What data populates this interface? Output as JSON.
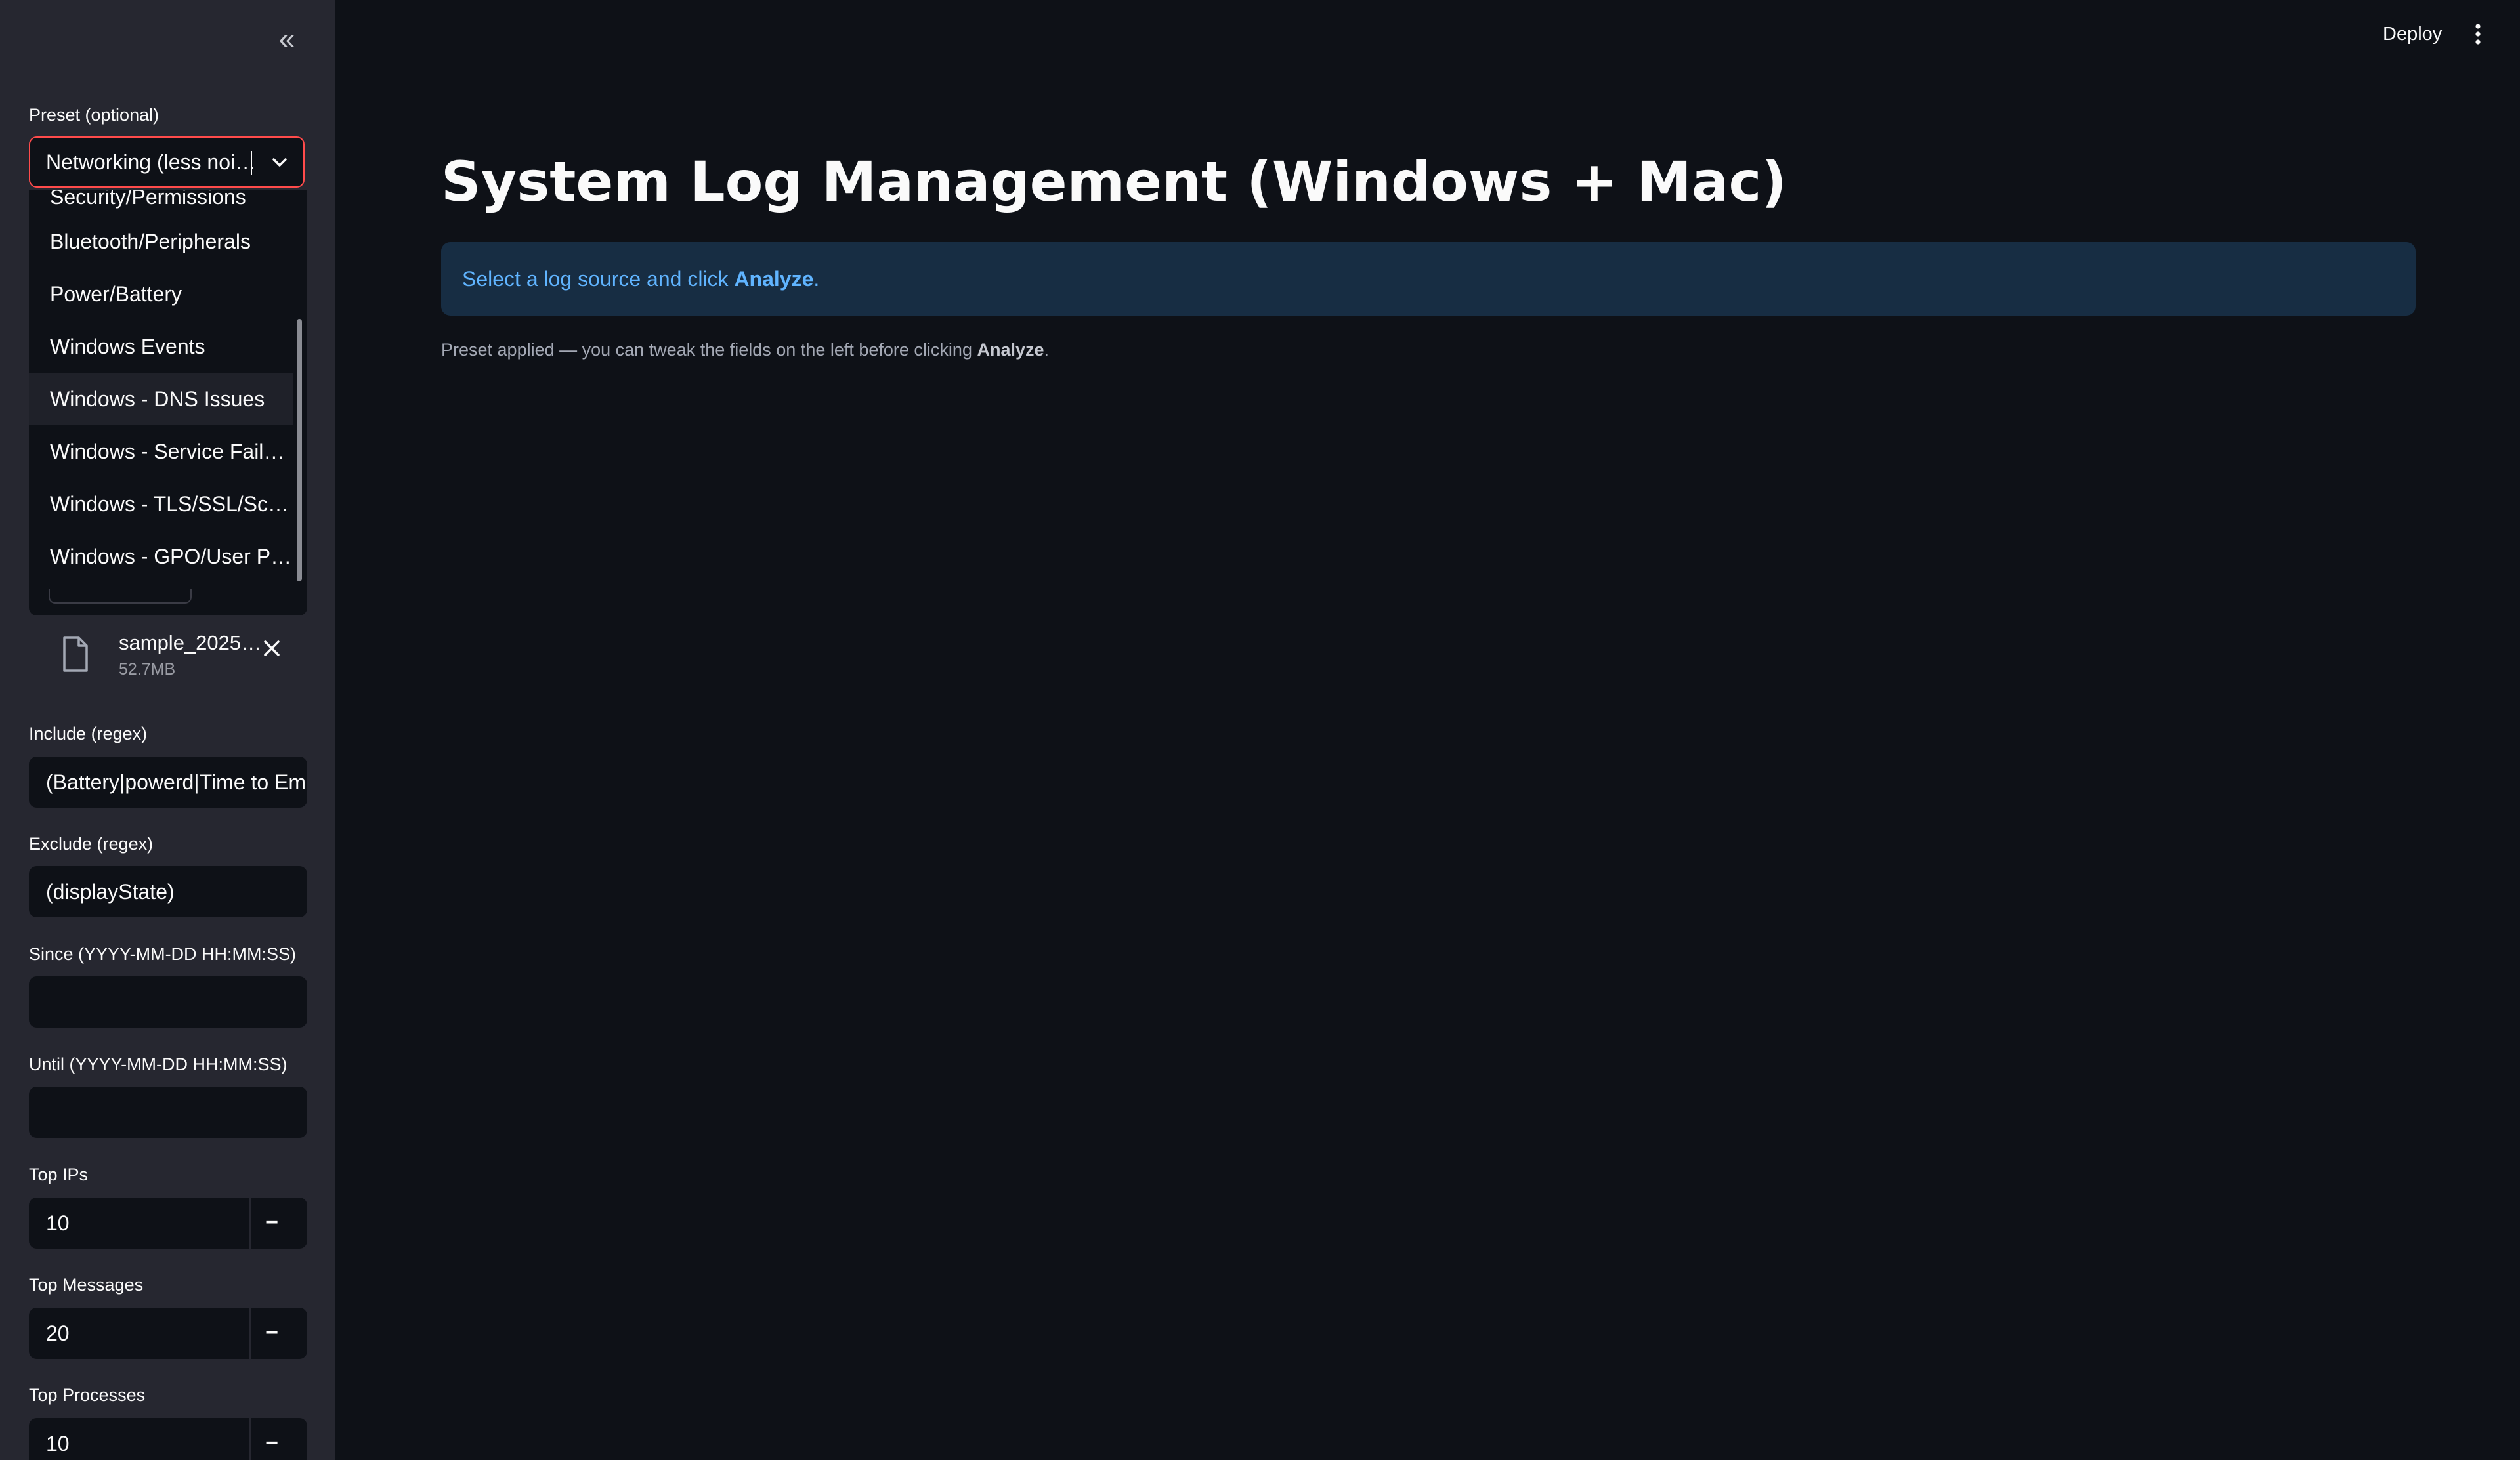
{
  "sidebar": {
    "collapse_icon": "double-chevron-left-icon",
    "preset": {
      "label": "Preset (optional)",
      "value": "Networking (less noi…",
      "options": [
        "Security/Permissions",
        "Bluetooth/Peripherals",
        "Power/Battery",
        "Windows Events",
        "Windows - DNS Issues",
        "Windows - Service Fail…",
        "Windows - TLS/SSL/Sc…",
        "Windows - GPO/User P…"
      ],
      "highlighted_option": "Windows - DNS Issues"
    },
    "file": {
      "name": "sample_2025…",
      "size": "52.7MB",
      "icon": "file-icon",
      "remove_icon": "close-icon"
    },
    "include": {
      "label": "Include (regex)",
      "value": "(Battery|powerd|Time to Emp"
    },
    "exclude": {
      "label": "Exclude (regex)",
      "value": "(displayState)"
    },
    "since": {
      "label": "Since (YYYY-MM-DD HH:MM:SS)",
      "value": ""
    },
    "until": {
      "label": "Until (YYYY-MM-DD HH:MM:SS)",
      "value": ""
    },
    "top_ips": {
      "label": "Top IPs",
      "value": "10"
    },
    "top_messages": {
      "label": "Top Messages",
      "value": "20"
    },
    "top_processes": {
      "label": "Top Processes",
      "value": "10"
    },
    "minus": "−",
    "plus": "+"
  },
  "header": {
    "deploy_label": "Deploy",
    "menu_icon": "vertical-ellipsis-icon"
  },
  "main": {
    "title": "System Log Management (Windows + Mac)",
    "info_prefix": "Select a log source and click ",
    "info_bold": "Analyze",
    "info_suffix": ".",
    "caption_prefix": "Preset applied — you can tweak the fields on the left before clicking ",
    "caption_bold": "Analyze",
    "caption_suffix": "."
  },
  "colors": {
    "background": "#0e1117",
    "sidebar": "#262730",
    "accent": "#ff4b4b",
    "info_bg": "#172d43",
    "info_text": "#60b4ff"
  }
}
